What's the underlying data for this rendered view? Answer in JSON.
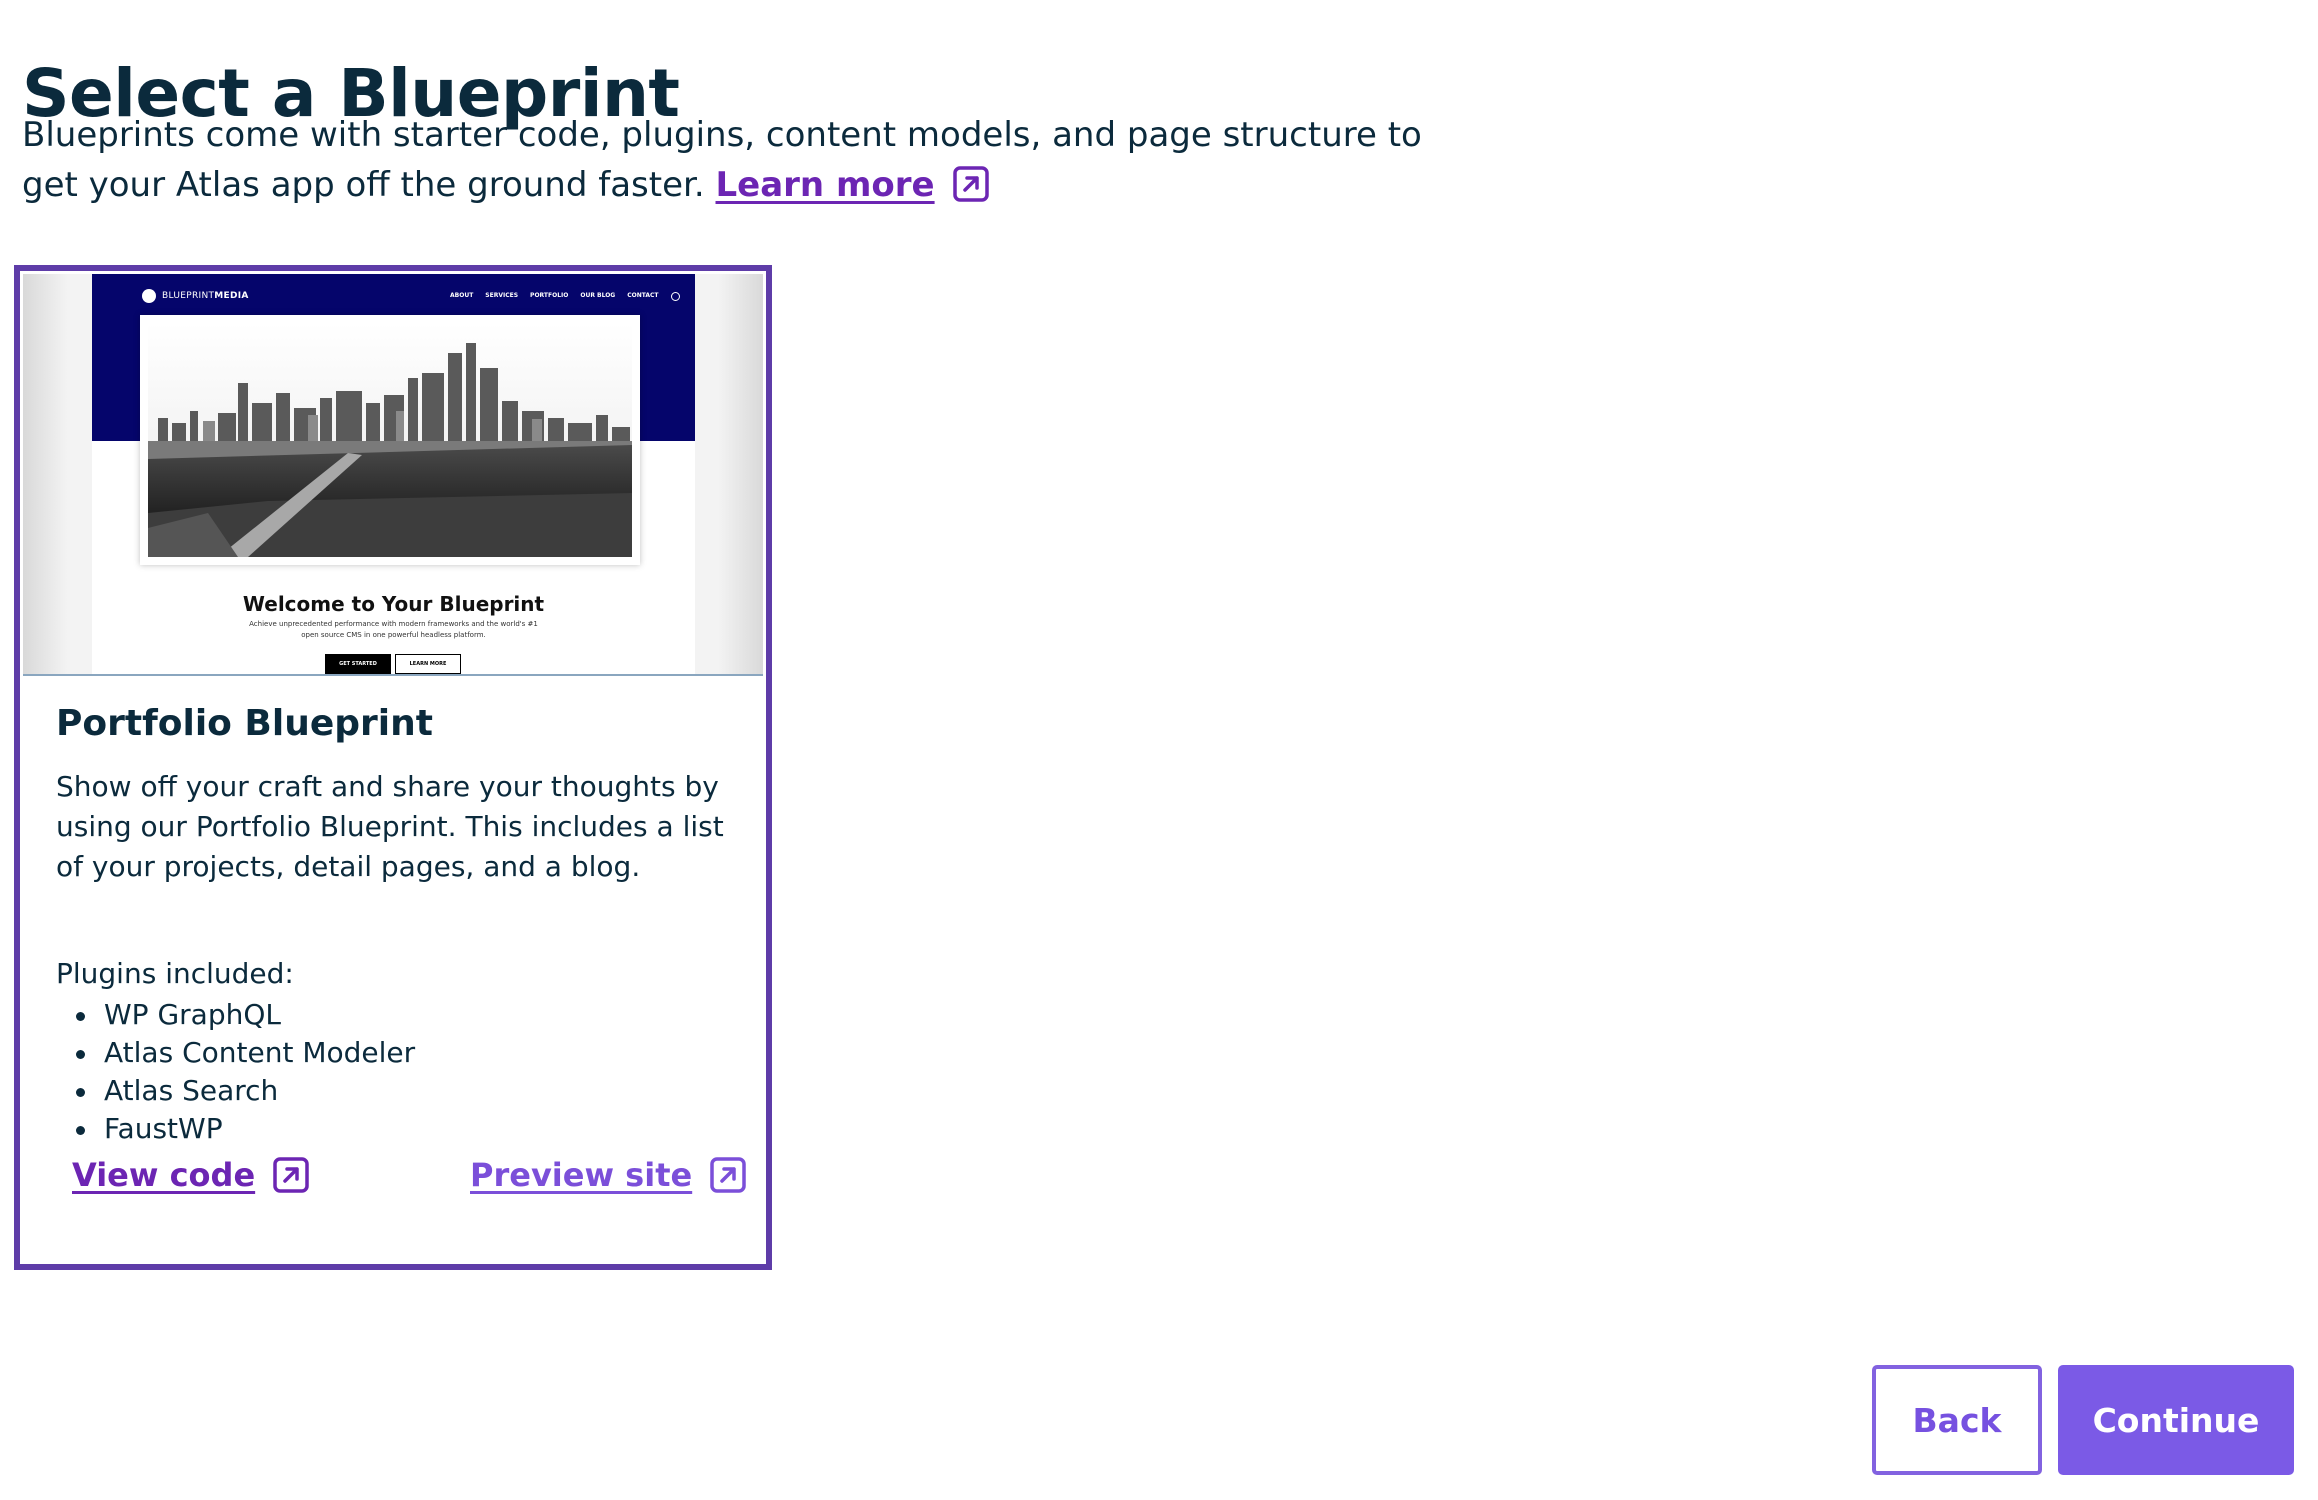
{
  "header": {
    "title": "Select a Blueprint",
    "description": "Blueprints come with starter code, plugins, content models, and page structure to get your Atlas app off the ground faster.",
    "learn_more_label": "Learn more",
    "learn_more_icon": "external-link-icon"
  },
  "card": {
    "selected": true,
    "preview": {
      "logo_text_light": "BLUEPRINT",
      "logo_text_bold": "MEDIA",
      "nav_items": [
        "ABOUT",
        "SERVICES",
        "PORTFOLIO",
        "OUR BLOG",
        "CONTACT"
      ],
      "heading": "Welcome to Your Blueprint",
      "subtext": "Achieve unprecedented performance with modern frameworks and the world's #1 open source CMS in one powerful headless platform.",
      "primary_button": "GET STARTED",
      "secondary_button": "LEARN MORE"
    },
    "title": "Portfolio Blueprint",
    "description": "Show off your craft and share your thoughts by using our Portfolio Blueprint. This includes a list of your projects, detail pages, and a blog.",
    "plugins_label": "Plugins included:",
    "plugins": [
      "WP GraphQL",
      "Atlas Content Modeler",
      "Atlas Search",
      "FaustWP"
    ],
    "view_code_label": "View code",
    "preview_site_label": "Preview site"
  },
  "footer": {
    "back_label": "Back",
    "continue_label": "Continue"
  },
  "colors": {
    "heading": "#0b2a3c",
    "link": "#6c25b3",
    "accent": "#7b5ae6",
    "card_border": "#5e3ca8",
    "preview_header": "#05056b"
  }
}
